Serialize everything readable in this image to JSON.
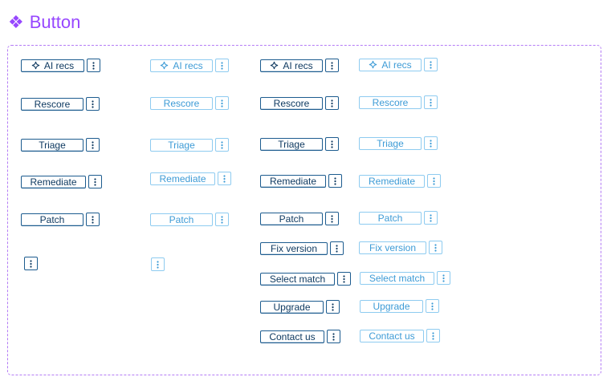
{
  "header": {
    "title": "Button",
    "icon": "component-diamond-icon",
    "accent": "#9747ff"
  },
  "colors": {
    "frame_border": "#b47cf5",
    "primary_text": "#0f3a61",
    "primary_border": "#1d5c8f",
    "secondary_text": "#3d9bd6",
    "secondary_border": "#8ecbf0"
  },
  "buttons": {
    "ai_recs": "AI recs",
    "rescore": "Rescore",
    "triage": "Triage",
    "remediate": "Remediate",
    "patch": "Patch",
    "fix_version": "Fix version",
    "select_match": "Select match",
    "upgrade": "Upgrade",
    "contact_us": "Contact us"
  },
  "icons": {
    "sparkle": "sparkle-icon",
    "more": "more-vertical-icon"
  }
}
